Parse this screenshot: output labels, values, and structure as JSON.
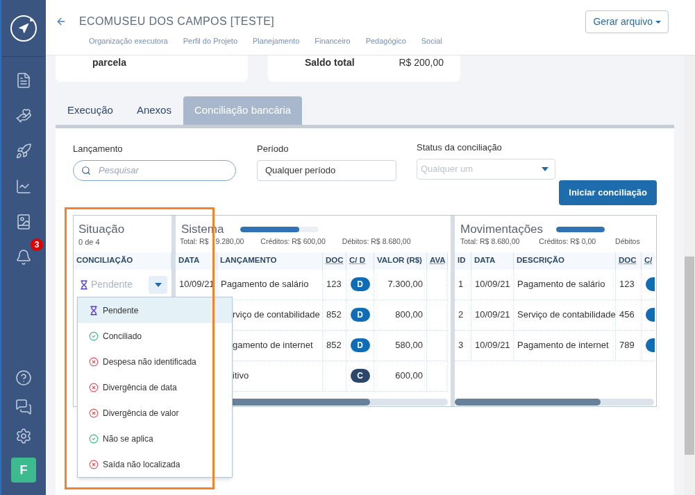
{
  "sidebar": {
    "notification_badge": "3",
    "avatar": "F"
  },
  "header": {
    "title": "ECOMUSEU DOS CAMPOS [TESTE]",
    "button": "Gerar arquivo",
    "nav": [
      "Organização executora",
      "Perfil do Projeto",
      "Planejamento",
      "Financeiro",
      "Pedagógico",
      "Social"
    ]
  },
  "cards": [
    {
      "label": "parcela"
    },
    {
      "label": "Saldo total",
      "value": "R$ 200,00"
    }
  ],
  "tabs": [
    {
      "label": "Execução",
      "selected": false
    },
    {
      "label": "Anexos",
      "selected": false
    },
    {
      "label": "Conciliação bancária",
      "selected": true
    }
  ],
  "filters": {
    "lancamento": {
      "label": "Lançamento",
      "placeholder": "Pesquisar"
    },
    "periodo": {
      "label": "Período",
      "value": "Qualquer período"
    },
    "status": {
      "label": "Status da conciliação",
      "placeholder": "Qualquer um"
    },
    "button": "Iniciar conciliação"
  },
  "situacao": {
    "title": "Situação",
    "count": "0 de 4",
    "column": "CONCILIAÇÃO",
    "value": "Pendente"
  },
  "sistema": {
    "title": "Sistema",
    "level": 0.75,
    "totals": [
      {
        "label": "Total: R$",
        "value": "9.280,00"
      },
      {
        "label": "Créditos: R$",
        "value": "600,00"
      },
      {
        "label": "Débitos: R$",
        "value": "8.680,00"
      }
    ],
    "columns": [
      "DATA",
      "LANÇAMENTO",
      "DOC",
      "C/ D",
      "VALOR (R$)",
      "AVA"
    ],
    "rows": [
      {
        "date": "10/09/21",
        "lancamento": "Pagamento de salário",
        "doc": "123",
        "cd": "D",
        "kind": "debit",
        "valor": "7.300,00"
      },
      {
        "lancamento": "rviço de contabilidade",
        "doc": "852",
        "cd": "D",
        "kind": "debit",
        "valor": "800,00"
      },
      {
        "lancamento": "gamento de internet",
        "doc": "852",
        "cd": "D",
        "kind": "debit",
        "valor": "580,00"
      },
      {
        "lancamento": "itivo",
        "cd": "C",
        "kind": "credit",
        "valor": "600,00"
      }
    ]
  },
  "movimentacoes": {
    "title": "Movimentações",
    "level": 1,
    "totals": [
      {
        "label": "Total: R$",
        "value": "8.680,00"
      },
      {
        "label": "Créditos: R$",
        "value": "0,00"
      },
      {
        "label": "Débitos"
      }
    ],
    "columns": [
      "ID",
      "DATA",
      "DESCRIÇÃO",
      "DOC",
      "C/"
    ],
    "rows": [
      {
        "id": "1",
        "date": "10/09/21",
        "descricao": "Pagamento de salário",
        "doc": "123"
      },
      {
        "id": "2",
        "date": "10/09/21",
        "descricao": "Serviço de contabilidade",
        "doc": "456"
      },
      {
        "id": "3",
        "date": "10/09/21",
        "descricao": "Pagamento de internet",
        "doc": "789"
      }
    ]
  },
  "dropdown": {
    "items": [
      {
        "label": "Pendente",
        "kind": "pending",
        "selected": true
      },
      {
        "label": "Conciliado",
        "kind": "ok",
        "selected": false
      },
      {
        "label": "Despesa não identificada",
        "kind": "error",
        "selected": false
      },
      {
        "label": "Divergência de data",
        "kind": "error",
        "selected": false
      },
      {
        "label": "Divergência de valor",
        "kind": "error",
        "selected": false
      },
      {
        "label": "Não se aplica",
        "kind": "ok",
        "selected": false
      },
      {
        "label": "Saída não localizada",
        "kind": "error",
        "selected": false
      }
    ]
  }
}
